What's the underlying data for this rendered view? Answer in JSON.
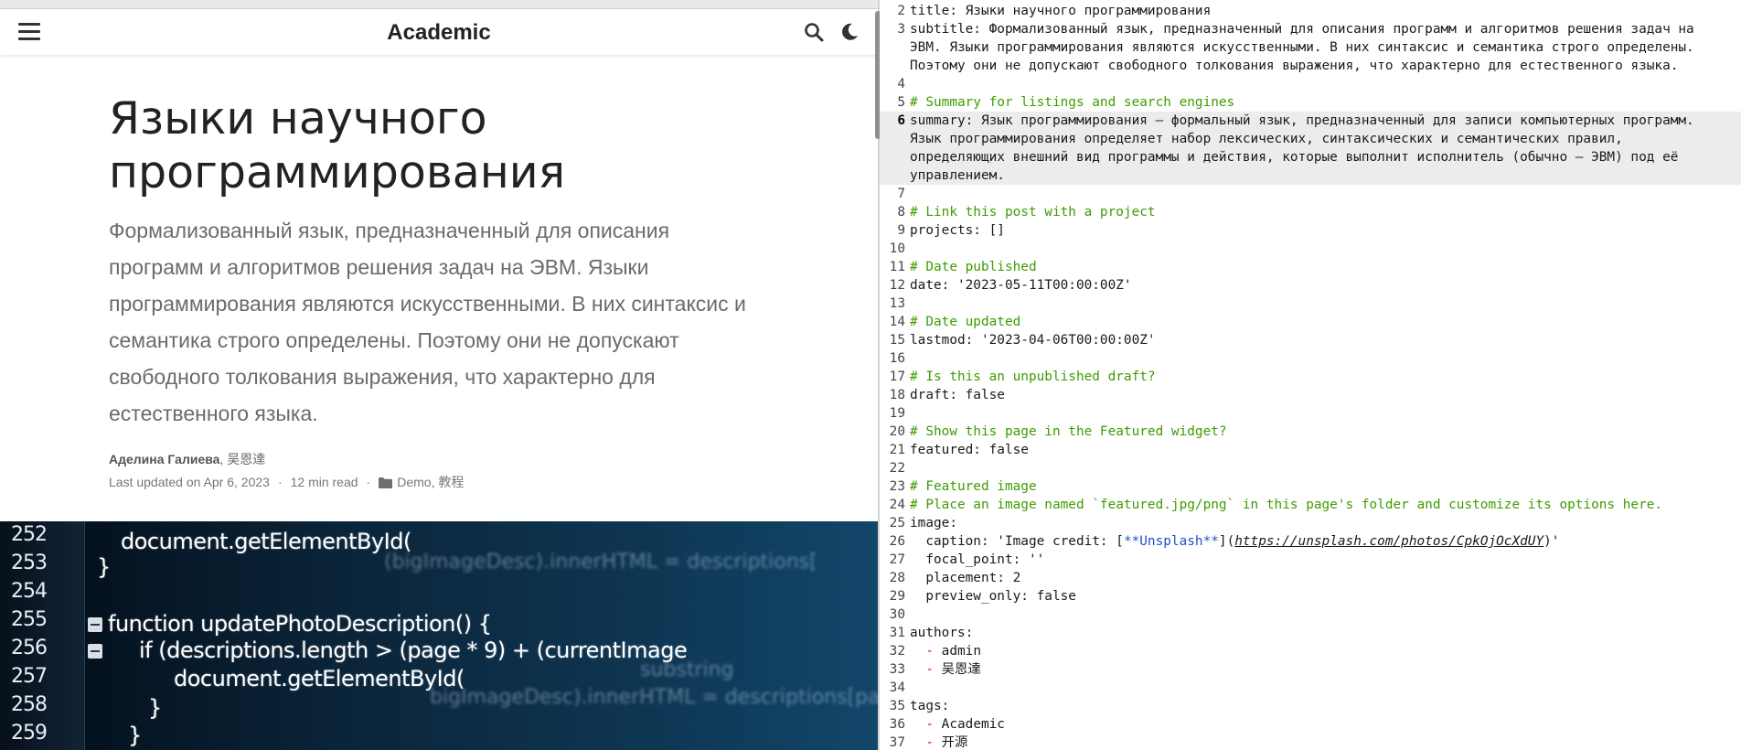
{
  "preview": {
    "site_title": "Academic",
    "post": {
      "title": "Языки научного программирования",
      "summary": "Формализованный язык, предназначенный для описания программ и алгоритмов решения задач на ЭВМ. Языки программирования являются искусственными. В них синтаксис и семантика строго определены. Поэтому они не допускают свободного толкования выражения, что характерно для естественного языка.",
      "authors": [
        "Аделина Галиева",
        "吴恩達"
      ],
      "author_separator": ", ",
      "last_updated": "Last updated on Apr 6, 2023",
      "read_time": "12 min read",
      "meta_separator": "·",
      "categories": [
        "Demo",
        "教程"
      ]
    },
    "hero_code": {
      "line_numbers": [
        "252",
        "253",
        "254",
        "255",
        "256",
        "257",
        "258",
        "259"
      ],
      "lines": [
        "document.getElementById(",
        "}",
        "function updatePhotoDescription() {",
        "if (descriptions.length > (page * 9) + (currentImage",
        "document.getElementById(",
        "}",
        "}"
      ],
      "ghost_text": [
        "(bigImageDesc).innerHTML = descriptions[",
        "substring",
        "bigImageDesc).innerHTML = descriptions[page"
      ]
    },
    "icons": {
      "menu": "hamburger-menu-icon",
      "search": "search-icon",
      "theme": "moon-icon",
      "category": "folder-icon"
    }
  },
  "editor": {
    "lines": [
      {
        "n": "2",
        "text": "title: Языки научного программирования"
      },
      {
        "n": "3",
        "text": "subtitle: Формализованный язык, предназначенный для описания программ и алгоритмов решения задач на"
      },
      {
        "n": "",
        "text": "ЭВМ. Языки программирования являются искусственными. В них синтаксис и семантика строго определены."
      },
      {
        "n": "",
        "text": "Поэтому они не допускают свободного толкования выражения, что характерно для естественного языка."
      },
      {
        "n": "4",
        "text": ""
      },
      {
        "n": "5",
        "text": "# Summary for listings and search engines",
        "kind": "comment"
      },
      {
        "n": "6",
        "text": "summary: Язык программирования — формальный язык, предназначенный для записи компьютерных программ.",
        "hl": true,
        "active": true
      },
      {
        "n": "",
        "text": "Язык программирования определяет набор лексических, синтаксических и семантических правил,",
        "hl": true
      },
      {
        "n": "",
        "text": "определяющих внешний вид программы и действия, которые выполнит исполнитель (обычно — ЭВМ) под её",
        "hl": true
      },
      {
        "n": "",
        "text": "управлением.",
        "hl": true
      },
      {
        "n": "7",
        "text": ""
      },
      {
        "n": "8",
        "text": "# Link this post with a project",
        "kind": "comment"
      },
      {
        "n": "9",
        "text": "projects: []"
      },
      {
        "n": "10",
        "text": ""
      },
      {
        "n": "11",
        "text": "# Date published",
        "kind": "comment"
      },
      {
        "n": "12",
        "text": "date: '2023-05-11T00:00:00Z'"
      },
      {
        "n": "13",
        "text": ""
      },
      {
        "n": "14",
        "text": "# Date updated",
        "kind": "comment"
      },
      {
        "n": "15",
        "text": "lastmod: '2023-04-06T00:00:00Z'"
      },
      {
        "n": "16",
        "text": ""
      },
      {
        "n": "17",
        "text": "# Is this an unpublished draft?",
        "kind": "comment"
      },
      {
        "n": "18",
        "text": "draft: false"
      },
      {
        "n": "19",
        "text": ""
      },
      {
        "n": "20",
        "text": "# Show this page in the Featured widget?",
        "kind": "comment"
      },
      {
        "n": "21",
        "text": "featured: false"
      },
      {
        "n": "22",
        "text": ""
      },
      {
        "n": "23",
        "text": "# Featured image",
        "kind": "comment"
      },
      {
        "n": "24",
        "text": "# Place an image named `featured.jpg/png` in this page's folder and customize its options here.",
        "kind": "comment"
      },
      {
        "n": "25",
        "text": "image:"
      },
      {
        "n": "26",
        "parts": [
          {
            "t": "  caption: 'Image credit: [",
            "c": ""
          },
          {
            "t": "**Unsplash**",
            "c": "bold"
          },
          {
            "t": "](",
            "c": ""
          },
          {
            "t": "https://unsplash.com/photos/CpkOjOcXdUY",
            "c": "link"
          },
          {
            "t": ")'",
            "c": ""
          }
        ]
      },
      {
        "n": "27",
        "text": "  focal_point: ''"
      },
      {
        "n": "28",
        "text": "  placement: 2"
      },
      {
        "n": "29",
        "text": "  preview_only: false"
      },
      {
        "n": "30",
        "text": ""
      },
      {
        "n": "31",
        "text": "authors:"
      },
      {
        "n": "32",
        "parts": [
          {
            "t": "  ",
            "c": ""
          },
          {
            "t": "-",
            "c": "dash"
          },
          {
            "t": " admin",
            "c": ""
          }
        ]
      },
      {
        "n": "33",
        "parts": [
          {
            "t": "  ",
            "c": ""
          },
          {
            "t": "-",
            "c": "dash"
          },
          {
            "t": " 吴恩達",
            "c": ""
          }
        ]
      },
      {
        "n": "34",
        "text": ""
      },
      {
        "n": "35",
        "text": "tags:"
      },
      {
        "n": "36",
        "parts": [
          {
            "t": "  ",
            "c": ""
          },
          {
            "t": "-",
            "c": "dash"
          },
          {
            "t": " Academic",
            "c": ""
          }
        ]
      },
      {
        "n": "37",
        "parts": [
          {
            "t": "  ",
            "c": ""
          },
          {
            "t": "-",
            "c": "dash"
          },
          {
            "t": " 开源",
            "c": ""
          }
        ]
      }
    ]
  },
  "colors": {
    "comment": "#3d9d00",
    "list_dash": "#cc1111",
    "markdown_bold": "#1f4fd1",
    "current_line_bg": "#ececec",
    "summary_text": "#6b6b6b",
    "hero_bg": "#0a2236"
  }
}
